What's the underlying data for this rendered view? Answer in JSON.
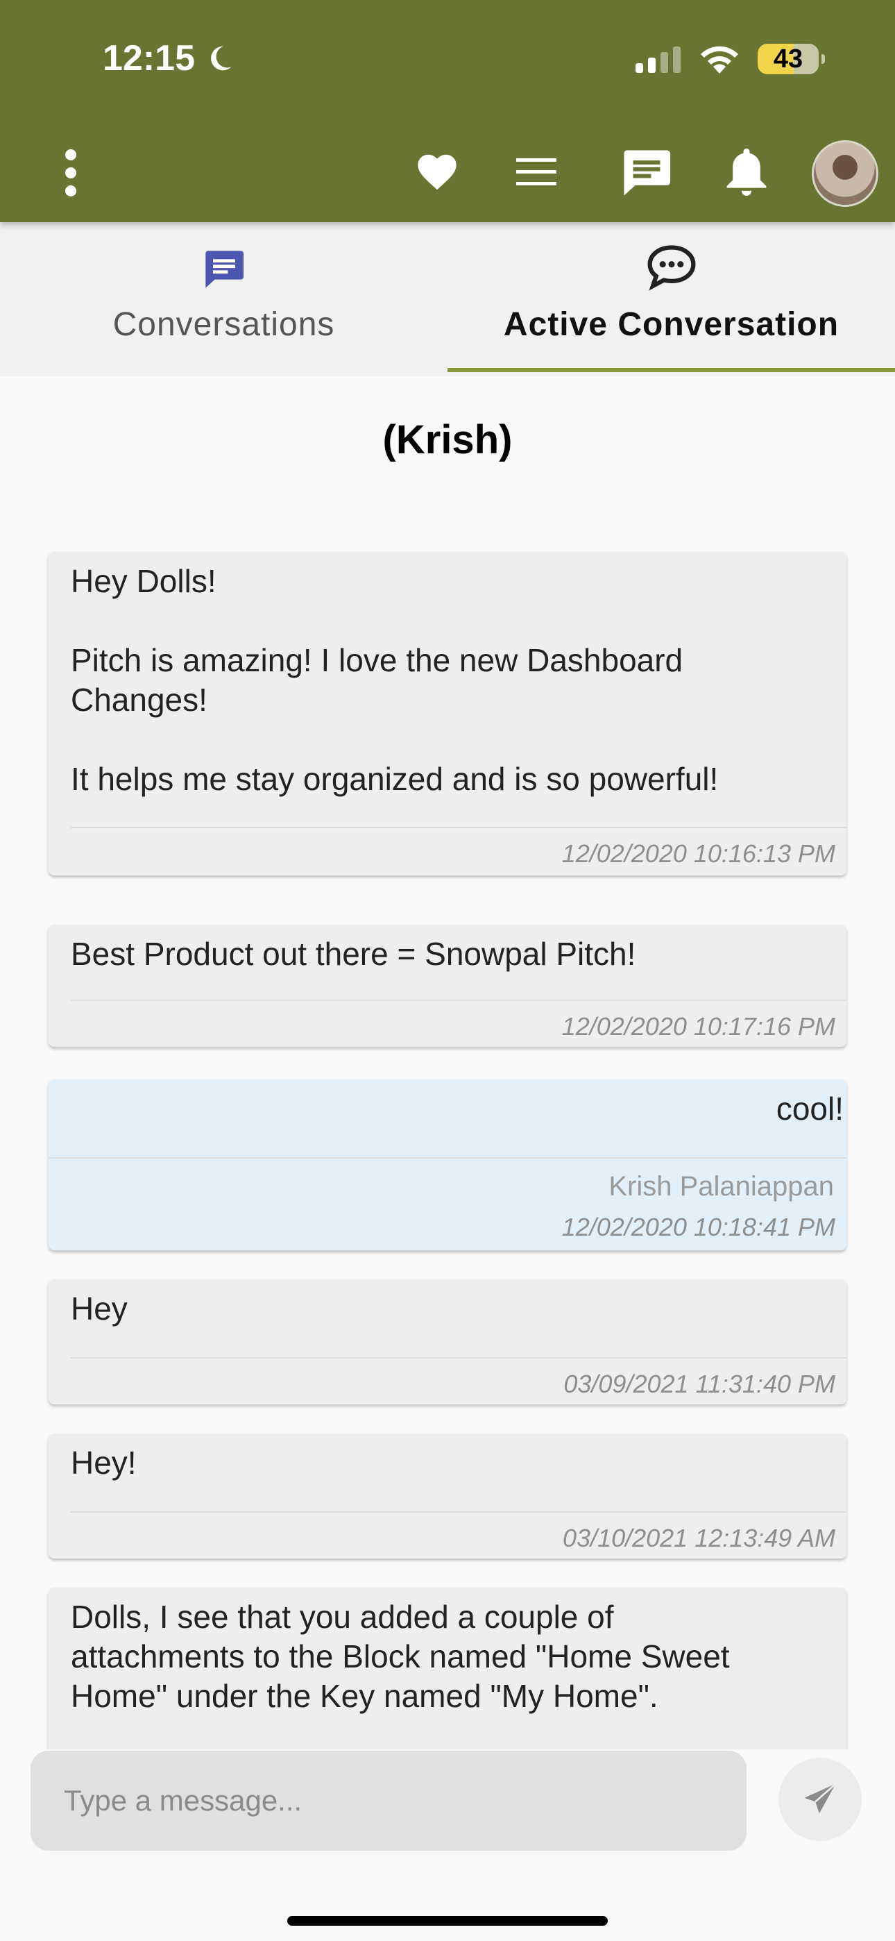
{
  "status_bar": {
    "time": "12:15",
    "battery": "43"
  },
  "toolbar": {
    "icons": [
      "more-vertical-icon",
      "heart-icon",
      "menu-icon",
      "chat-icon",
      "bell-icon",
      "avatar"
    ]
  },
  "tabs": [
    {
      "label": "Conversations",
      "icon": "chat-bubble-lines-icon",
      "active": false
    },
    {
      "label": "Active Conversation",
      "icon": "chat-dots-icon",
      "active": true
    }
  ],
  "conversation": {
    "title": "(Krish)"
  },
  "messages": [
    {
      "text": "Hey Dolls!\n\nPitch is amazing! I love the new Dashboard\nChanges!\n\nIt helps me stay organized and is so powerful!",
      "sender": "",
      "timestamp": "12/02/2020 10:16:13 PM",
      "mine": false
    },
    {
      "text": "Best Product out there = Snowpal Pitch!",
      "sender": "",
      "timestamp": "12/02/2020 10:17:16 PM",
      "mine": false
    },
    {
      "text": "cool!",
      "sender": "Krish Palaniappan",
      "timestamp": "12/02/2020 10:18:41 PM",
      "mine": true
    },
    {
      "text": "Hey",
      "sender": "",
      "timestamp": "03/09/2021 11:31:40 PM",
      "mine": false
    },
    {
      "text": "Hey!",
      "sender": "",
      "timestamp": "03/10/2021 12:13:49 AM",
      "mine": false
    },
    {
      "text": "Dolls, I see that you added a couple of\nattachments to the Block named \"Home Sweet\nHome\" under the Key named \"My Home\".",
      "sender": "",
      "timestamp": "",
      "mine": false
    }
  ],
  "composer": {
    "placeholder": "Type a message..."
  },
  "colors": {
    "header": "#687532",
    "tab_underline": "#8a9a3a",
    "conversations_icon": "#4a56b0",
    "own_message_bg": "#e3f0fa"
  }
}
